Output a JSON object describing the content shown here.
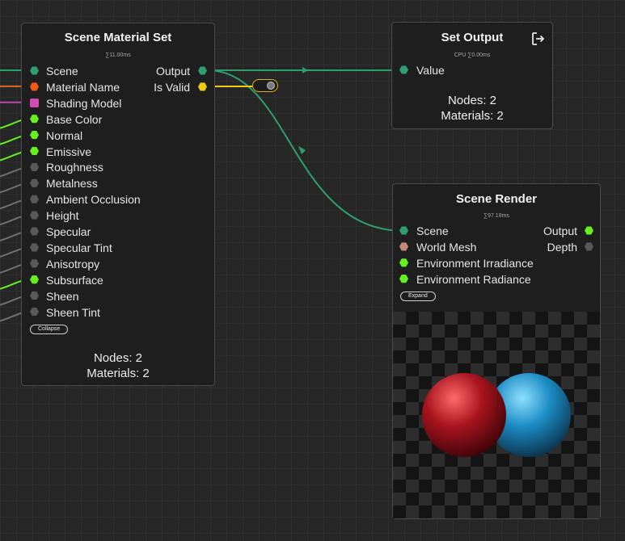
{
  "nodes": {
    "scene_material_set": {
      "title": "Scene Material Set",
      "timing": "∑11.00ms",
      "inputs": [
        {
          "label": "Scene",
          "color": "#2e9e6e",
          "shape": "hex",
          "wire": "#2e9e6e"
        },
        {
          "label": "Material Name",
          "color": "#f05a14",
          "shape": "hex",
          "wire": "#e0661e"
        },
        {
          "label": "Shading Model",
          "color": "#d04cb0",
          "shape": "square",
          "wire": "#b64ca8"
        },
        {
          "label": "Base Color",
          "color": "#66f020",
          "shape": "hex",
          "wire": "#66f020"
        },
        {
          "label": "Normal",
          "color": "#66f020",
          "shape": "hex",
          "wire": "#66f020"
        },
        {
          "label": "Emissive",
          "color": "#66f020",
          "shape": "hex",
          "wire": "#66f020"
        },
        {
          "label": "Roughness",
          "color": "#595959",
          "shape": "hex",
          "wire": "#707070"
        },
        {
          "label": "Metalness",
          "color": "#595959",
          "shape": "hex",
          "wire": "#707070"
        },
        {
          "label": "Ambient Occlusion",
          "color": "#595959",
          "shape": "hex",
          "wire": "#707070"
        },
        {
          "label": "Height",
          "color": "#595959",
          "shape": "hex",
          "wire": "#707070"
        },
        {
          "label": "Specular",
          "color": "#595959",
          "shape": "hex",
          "wire": "#707070"
        },
        {
          "label": "Specular Tint",
          "color": "#595959",
          "shape": "hex",
          "wire": "#707070"
        },
        {
          "label": "Anisotropy",
          "color": "#595959",
          "shape": "hex",
          "wire": "#707070"
        },
        {
          "label": "Subsurface",
          "color": "#66f020",
          "shape": "hex",
          "wire": "#66f020"
        },
        {
          "label": "Sheen",
          "color": "#595959",
          "shape": "hex",
          "wire": "#707070"
        },
        {
          "label": "Sheen Tint",
          "color": "#595959",
          "shape": "hex",
          "wire": "#707070"
        }
      ],
      "outputs": [
        {
          "label": "Output",
          "color": "#2e9e6e",
          "shape": "hex"
        },
        {
          "label": "Is Valid",
          "color": "#f0cc10",
          "shape": "hex"
        }
      ],
      "collapse_label": "Collapse",
      "stats": {
        "nodes": "Nodes: 2",
        "materials": "Materials: 2"
      }
    },
    "set_output": {
      "title": "Set Output",
      "timing": "CPU ∑0.00ms",
      "inputs": [
        {
          "label": "Value",
          "color": "#2e9e6e",
          "shape": "hex"
        }
      ],
      "icon": "exit-icon",
      "stats": {
        "nodes": "Nodes: 2",
        "materials": "Materials: 2"
      }
    },
    "scene_render": {
      "title": "Scene Render",
      "timing": "∑97.18ms",
      "inputs": [
        {
          "label": "Scene",
          "color": "#2e9e6e",
          "shape": "hex"
        },
        {
          "label": "World Mesh",
          "color": "#c48a78",
          "shape": "hex"
        },
        {
          "label": "Environment Irradiance",
          "color": "#66f020",
          "shape": "hex"
        },
        {
          "label": "Environment Radiance",
          "color": "#66f020",
          "shape": "hex"
        }
      ],
      "outputs": [
        {
          "label": "Output",
          "color": "#66f020",
          "shape": "hex"
        },
        {
          "label": "Depth",
          "color": "#595959",
          "shape": "hex"
        }
      ],
      "expand_label": "Expand",
      "preview": {
        "sphere_left_color": "#a8141e",
        "sphere_right_color": "#1c8cc4"
      }
    }
  },
  "wires": {
    "scene_link_color": "#2e9e6e",
    "valid_link_color": "#f0cc10"
  }
}
